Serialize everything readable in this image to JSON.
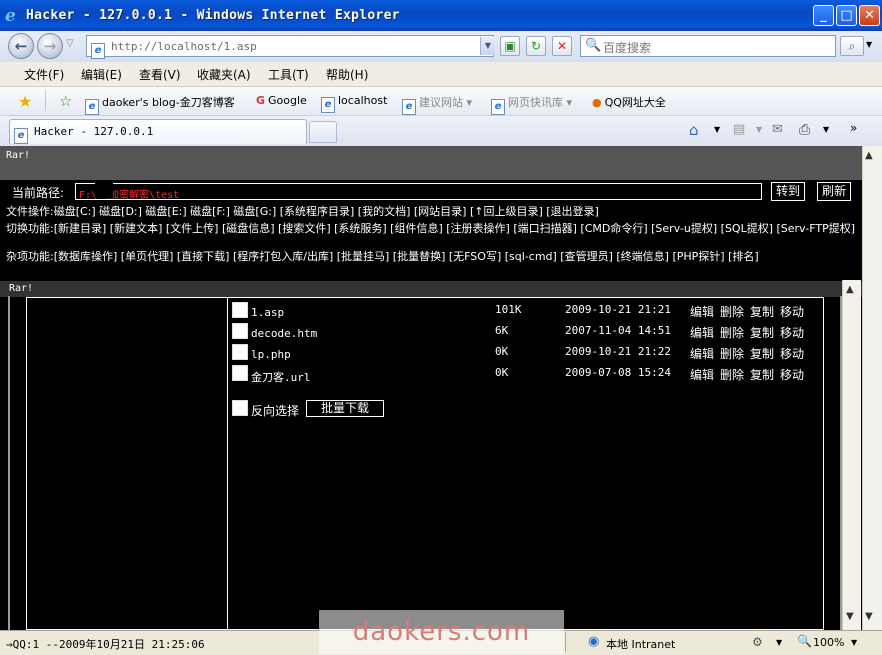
{
  "window": {
    "title": "Hacker - 127.0.0.1 - Windows Internet Explorer"
  },
  "address": {
    "url": "http://localhost/1.asp",
    "search_placeholder": "百度搜索"
  },
  "menu": [
    "文件(F)",
    "编辑(E)",
    "查看(V)",
    "收藏夹(A)",
    "工具(T)",
    "帮助(H)"
  ],
  "favorites": [
    "daoker's blog-金刀客博客",
    "Google",
    "localhost",
    "建议网站",
    "网页快讯库",
    "QQ网址大全"
  ],
  "tab": {
    "title": "Hacker - 127.0.0.1"
  },
  "page": {
    "rar_top": "Rar!",
    "path_label": "当前路径:",
    "path_value": "F:\\          \\加密解密\\test",
    "go": "转到",
    "refresh": "刷新",
    "file_ops": "文件操作:磁盘[C:] 磁盘[D:] 磁盘[E:] 磁盘[F:] 磁盘[G:] [系统程序目录] [我的文档] [网站目录] [↑回上级目录] [退出登录]",
    "switch_ops": "切换功能:[新建目录] [新建文本] [文件上传] [磁盘信息] [搜索文件] [系统服务] [组件信息] [注册表操作] [端口扫描器] [CMD命令行] [Serv-u提权] [SQL提权] [Serv-FTP提权]",
    "misc_ops": "杂项功能:[数据库操作] [单页代理] [直接下载] [程序打包入库/出库] [批量挂马] [批量替换] [无FSO写] [sql-cmd] [查管理员] [终端信息] [PHP探针] [排名]",
    "rar_inner": "Rar!",
    "files": [
      {
        "name": "1.asp",
        "size": "101K",
        "date": "2009-10-21 21:21"
      },
      {
        "name": "decode.htm",
        "size": "6K",
        "date": "2007-11-04 14:51"
      },
      {
        "name": "lp.php",
        "size": "0K",
        "date": "2009-10-21 21:22"
      },
      {
        "name": "金刀客.url",
        "size": "0K",
        "date": "2009-07-08 15:24"
      }
    ],
    "actions": {
      "edit": "编辑",
      "delete": "删除",
      "copy": "复制",
      "move": "移动"
    },
    "reverse_select": "反向选择",
    "batch_download": "批量下载"
  },
  "status": {
    "text": "→QQ:1  --2009年10月21日 21:25:06",
    "zone": "本地 Intranet",
    "zoom": "100%"
  },
  "watermark": "daokers.com"
}
